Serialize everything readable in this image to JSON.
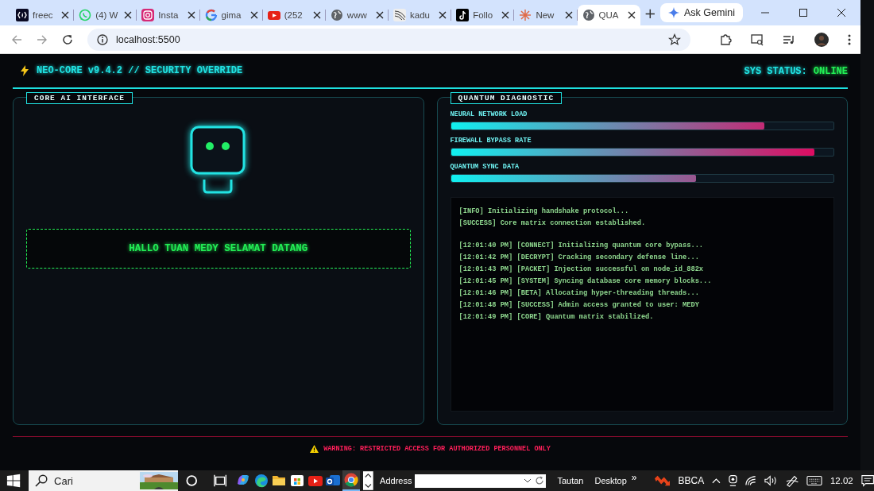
{
  "browser": {
    "tabs": [
      {
        "title": "freec",
        "kind": "code",
        "selected": false
      },
      {
        "title": "(4) W",
        "kind": "chat",
        "selected": false
      },
      {
        "title": "Insta",
        "kind": "camera",
        "selected": false
      },
      {
        "title": "gima",
        "kind": "search",
        "selected": false
      },
      {
        "title": "(252",
        "kind": "video",
        "selected": false
      },
      {
        "title": "www",
        "kind": "web",
        "selected": false
      },
      {
        "title": "kadu",
        "kind": "wave",
        "selected": false
      },
      {
        "title": "Follo",
        "kind": "music",
        "selected": false
      },
      {
        "title": "New",
        "kind": "spark",
        "selected": false
      },
      {
        "title": "QUA",
        "kind": "web",
        "selected": true
      }
    ],
    "new_tab": "+",
    "gemini": "Ask Gemini",
    "address": "localhost:5500"
  },
  "page": {
    "header": {
      "title": "NEO-CORE v9.4.2 // SECURITY OVERRIDE",
      "status_label": "SYS STATUS:",
      "status_value": "ONLINE"
    },
    "ai_panel": {
      "title": "CORE AI INTERFACE",
      "greeting": "HALLO TUAN MEDY SELAMAT DATANG"
    },
    "diagnostic_panel": {
      "title": "QUANTUM DIAGNOSTIC",
      "meters": [
        {
          "name": "NEURAL NETWORK LOAD",
          "level": 0.82
        },
        {
          "name": "FIREWALL BYPASS RATE",
          "level": 0.95
        },
        {
          "name": "QUANTUM SYNC DATA",
          "level": 0.64
        }
      ],
      "log_groups": [
        [
          "[INFO] Initializing handshake protocol...",
          "[SUCCESS] Core matrix connection established."
        ],
        [
          "[12:01:40 PM] [CONNECT] Initializing quantum core bypass...",
          "[12:01:42 PM] [DECRYPT] Cracking secondary defense line...",
          "[12:01:43 PM] [PACKET] Injection successful on node_id_882x",
          "[12:01:45 PM] [SYSTEM] Syncing database core memory blocks...",
          "[12:01:46 PM] [BETA] Allocating hyper-threading threads...",
          "[12:01:48 PM] [SUCCESS] Admin access granted to user: MEDY",
          "[12:01:49 PM] [CORE] Quantum matrix stabilized."
        ]
      ]
    },
    "warning": "WARNING: RESTRICTED ACCESS FOR AUTHORIZED PERSONNEL ONLY"
  },
  "taskbar": {
    "search_placeholder": "Cari",
    "apps": [
      {
        "kind": "assistant",
        "selected": false
      },
      {
        "kind": "browser",
        "selected": false
      },
      {
        "kind": "folder",
        "selected": false
      },
      {
        "kind": "store",
        "selected": false
      },
      {
        "kind": "video",
        "selected": false
      },
      {
        "kind": "mail",
        "selected": false
      },
      {
        "kind": "chrome",
        "selected": true
      }
    ],
    "address_label": "Address",
    "links": [
      "Tautan",
      "Desktop"
    ],
    "more": "»",
    "ticker": "BBCA",
    "time": "12.02"
  }
}
